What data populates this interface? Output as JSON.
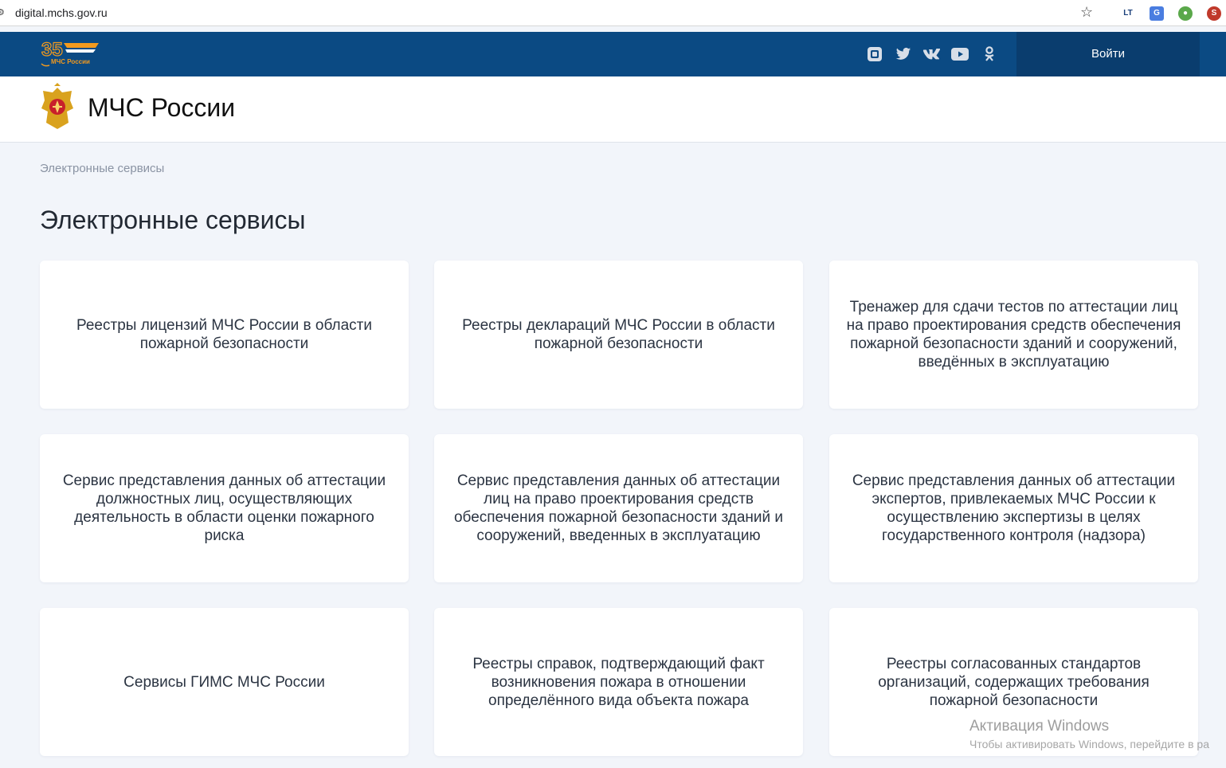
{
  "browser": {
    "url": "digital.mchs.gov.ru"
  },
  "topbar": {
    "logo_text": "МЧС России",
    "logo_years": "35",
    "social_icons": [
      "rutube-icon",
      "twitter-icon",
      "vk-icon",
      "youtube-icon",
      "odnoklassniki-icon"
    ],
    "login_label": "Войти"
  },
  "header": {
    "title": "МЧС России"
  },
  "breadcrumb": "Электронные сервисы",
  "page_title": "Электронные сервисы",
  "cards": [
    {
      "text": "Реестры лицензий МЧС России в области пожарной безопасности"
    },
    {
      "text": "Реестры деклараций МЧС России в области пожарной безопасности"
    },
    {
      "text": "Тренажер для сдачи тестов по аттестации лиц на право проектирования средств обеспечения пожарной безопасности зданий и сооружений, введённых в эксплуатацию"
    },
    {
      "text": "Сервис представления данных об аттестации должностных лиц, осуществляющих деятельность в области оценки пожарного риска"
    },
    {
      "text": "Сервис представления данных об аттестации лиц на право проектирования средств обеспечения пожарной безопасности зданий и сооружений, введенных в эксплуатацию"
    },
    {
      "text": "Сервис представления данных об аттестации экспертов, привлекаемых МЧС России к осуществлению экспертизы в целях государственного контроля (надзора)"
    },
    {
      "text": "Сервисы ГИМС МЧС России"
    },
    {
      "text": "Реестры справок, подтверждающий факт возникновения пожара в отношении определённого вида объекта пожара"
    },
    {
      "text": "Реестры согласованных стандартов организаций, содержащих требования пожарной безопасности"
    }
  ],
  "watermark": {
    "title": "Активация Windows",
    "subtitle": "Чтобы активировать Windows, перейдите в ра"
  },
  "colors": {
    "topbar": "#0b4a83",
    "login_bg": "#0a3d6e",
    "page_bg": "#f2f5fa",
    "logo_orange": "#f39a1e"
  }
}
